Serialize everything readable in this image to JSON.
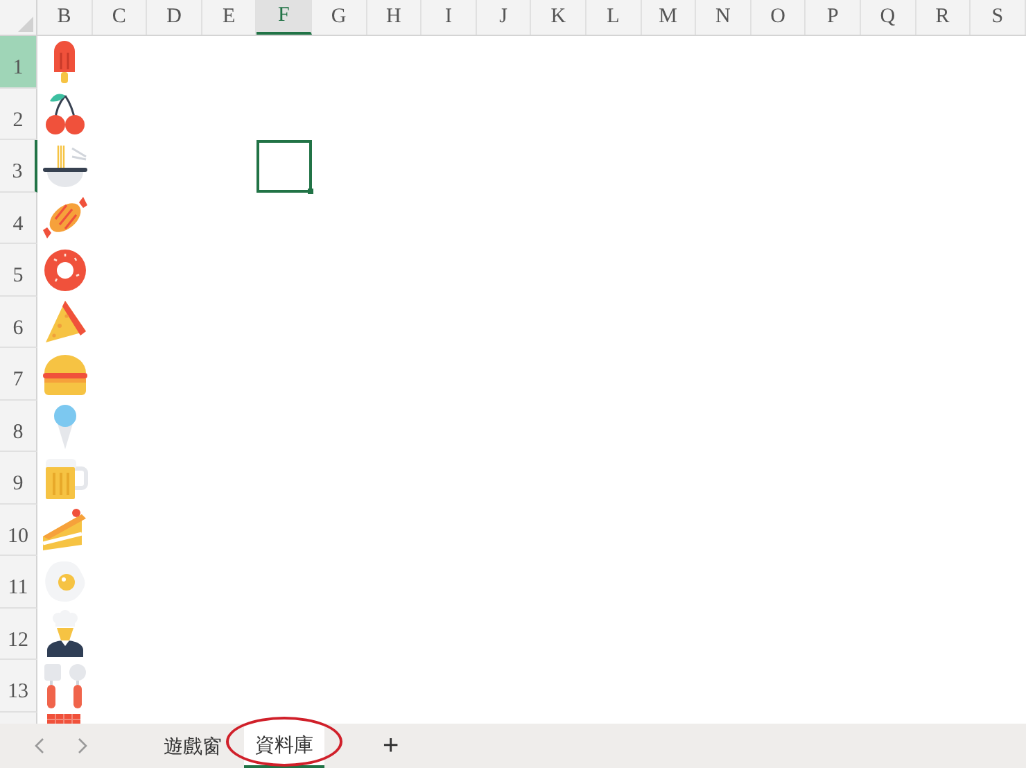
{
  "columns": [
    {
      "label": "B",
      "selected": false
    },
    {
      "label": "C",
      "selected": false
    },
    {
      "label": "D",
      "selected": false
    },
    {
      "label": "E",
      "selected": false
    },
    {
      "label": "F",
      "selected": true
    },
    {
      "label": "G",
      "selected": false
    },
    {
      "label": "H",
      "selected": false
    },
    {
      "label": "I",
      "selected": false
    },
    {
      "label": "J",
      "selected": false
    },
    {
      "label": "K",
      "selected": false
    },
    {
      "label": "L",
      "selected": false
    },
    {
      "label": "M",
      "selected": false
    },
    {
      "label": "N",
      "selected": false
    },
    {
      "label": "O",
      "selected": false
    },
    {
      "label": "P",
      "selected": false
    },
    {
      "label": "Q",
      "selected": false
    },
    {
      "label": "R",
      "selected": false
    },
    {
      "label": "S",
      "selected": false
    }
  ],
  "rows": [
    {
      "label": "1",
      "selected": false,
      "highlighted": true
    },
    {
      "label": "2",
      "selected": false,
      "highlighted": false
    },
    {
      "label": "3",
      "selected": true,
      "highlighted": false
    },
    {
      "label": "4",
      "selected": false,
      "highlighted": false
    },
    {
      "label": "5",
      "selected": false,
      "highlighted": false
    },
    {
      "label": "6",
      "selected": false,
      "highlighted": false
    },
    {
      "label": "7",
      "selected": false,
      "highlighted": false
    },
    {
      "label": "8",
      "selected": false,
      "highlighted": false
    },
    {
      "label": "9",
      "selected": false,
      "highlighted": false
    },
    {
      "label": "10",
      "selected": false,
      "highlighted": false
    },
    {
      "label": "11",
      "selected": false,
      "highlighted": false
    },
    {
      "label": "12",
      "selected": false,
      "highlighted": false
    },
    {
      "label": "13",
      "selected": false,
      "highlighted": false
    }
  ],
  "sheet_tabs": [
    {
      "label": "遊戲窗",
      "selected": false,
      "circled": false
    },
    {
      "label": "資料庫",
      "selected": true,
      "circled": true
    }
  ],
  "add_sheet": "+"
}
